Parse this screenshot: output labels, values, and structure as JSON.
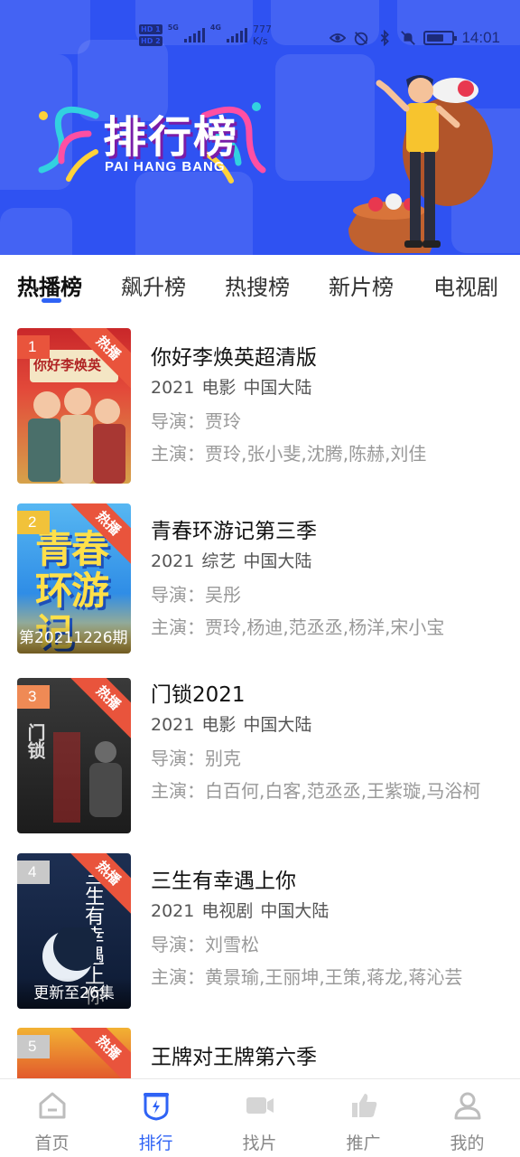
{
  "status_bar": {
    "network_1": "5G",
    "network_2": "4G",
    "speed_value": "777",
    "speed_unit": "K/s",
    "time": "14:01"
  },
  "banner": {
    "title_cn": "排行榜",
    "title_en": "PAI HANG BANG"
  },
  "tabs": [
    {
      "label": "热播榜",
      "active": true
    },
    {
      "label": "飙升榜",
      "active": false
    },
    {
      "label": "热搜榜",
      "active": false
    },
    {
      "label": "新片榜",
      "active": false
    },
    {
      "label": "电视剧",
      "active": false
    }
  ],
  "list": [
    {
      "rank": "1",
      "badge": "热播",
      "title": "你好李焕英超清版",
      "year": "2021",
      "type": "电影",
      "region": "中国大陆",
      "director_label": "导演：",
      "director": "贾玲",
      "cast_label": "主演：",
      "cast": "贾玲,张小斐,沈腾,陈赫,刘佳",
      "poster_caption": "",
      "poster_title": "你好李焕英"
    },
    {
      "rank": "2",
      "badge": "热播",
      "title": "青春环游记第三季",
      "year": "2021",
      "type": "综艺",
      "region": "中国大陆",
      "director_label": "导演：",
      "director": "吴彤",
      "cast_label": "主演：",
      "cast": "贾玲,杨迪,范丞丞,杨洋,宋小宝",
      "poster_caption": "第20211226期",
      "poster_title": "青春环游记"
    },
    {
      "rank": "3",
      "badge": "热播",
      "title": "门锁2021",
      "year": "2021",
      "type": "电影",
      "region": "中国大陆",
      "director_label": "导演：",
      "director": "别克",
      "cast_label": "主演：",
      "cast": "白百何,白客,范丞丞,王紫璇,马浴柯",
      "poster_caption": "",
      "poster_title": "门锁"
    },
    {
      "rank": "4",
      "badge": "热播",
      "title": "三生有幸遇上你",
      "year": "2021",
      "type": "电视剧",
      "region": "中国大陆",
      "director_label": "导演：",
      "director": "刘雪松",
      "cast_label": "主演：",
      "cast": "黄景瑜,王丽坤,王策,蒋龙,蒋沁芸",
      "poster_caption": "更新至26集",
      "poster_title": "三生有幸遇上你"
    },
    {
      "rank": "5",
      "badge": "热播",
      "title": "王牌对王牌第六季",
      "year": "",
      "type": "",
      "region": "",
      "director_label": "",
      "director": "",
      "cast_label": "",
      "cast": "",
      "poster_caption": "",
      "poster_title": ""
    }
  ],
  "bottom_nav": [
    {
      "label": "首页",
      "icon": "home-icon",
      "active": false
    },
    {
      "label": "排行",
      "icon": "ranking-shield-icon",
      "active": true
    },
    {
      "label": "找片",
      "icon": "video-camera-icon",
      "active": false
    },
    {
      "label": "推广",
      "icon": "thumbs-up-icon",
      "active": false
    },
    {
      "label": "我的",
      "icon": "user-icon",
      "active": false
    }
  ],
  "colors": {
    "banner_bg": "#2f52f2",
    "accent": "#2f63f5",
    "hot_badge": "#e9543c",
    "rank_1": "#e9543c",
    "rank_2": "#f1c23a",
    "rank_3": "#ef8a55",
    "rank_4": "#c9c9c9",
    "rank_5": "#c9c9c9"
  }
}
